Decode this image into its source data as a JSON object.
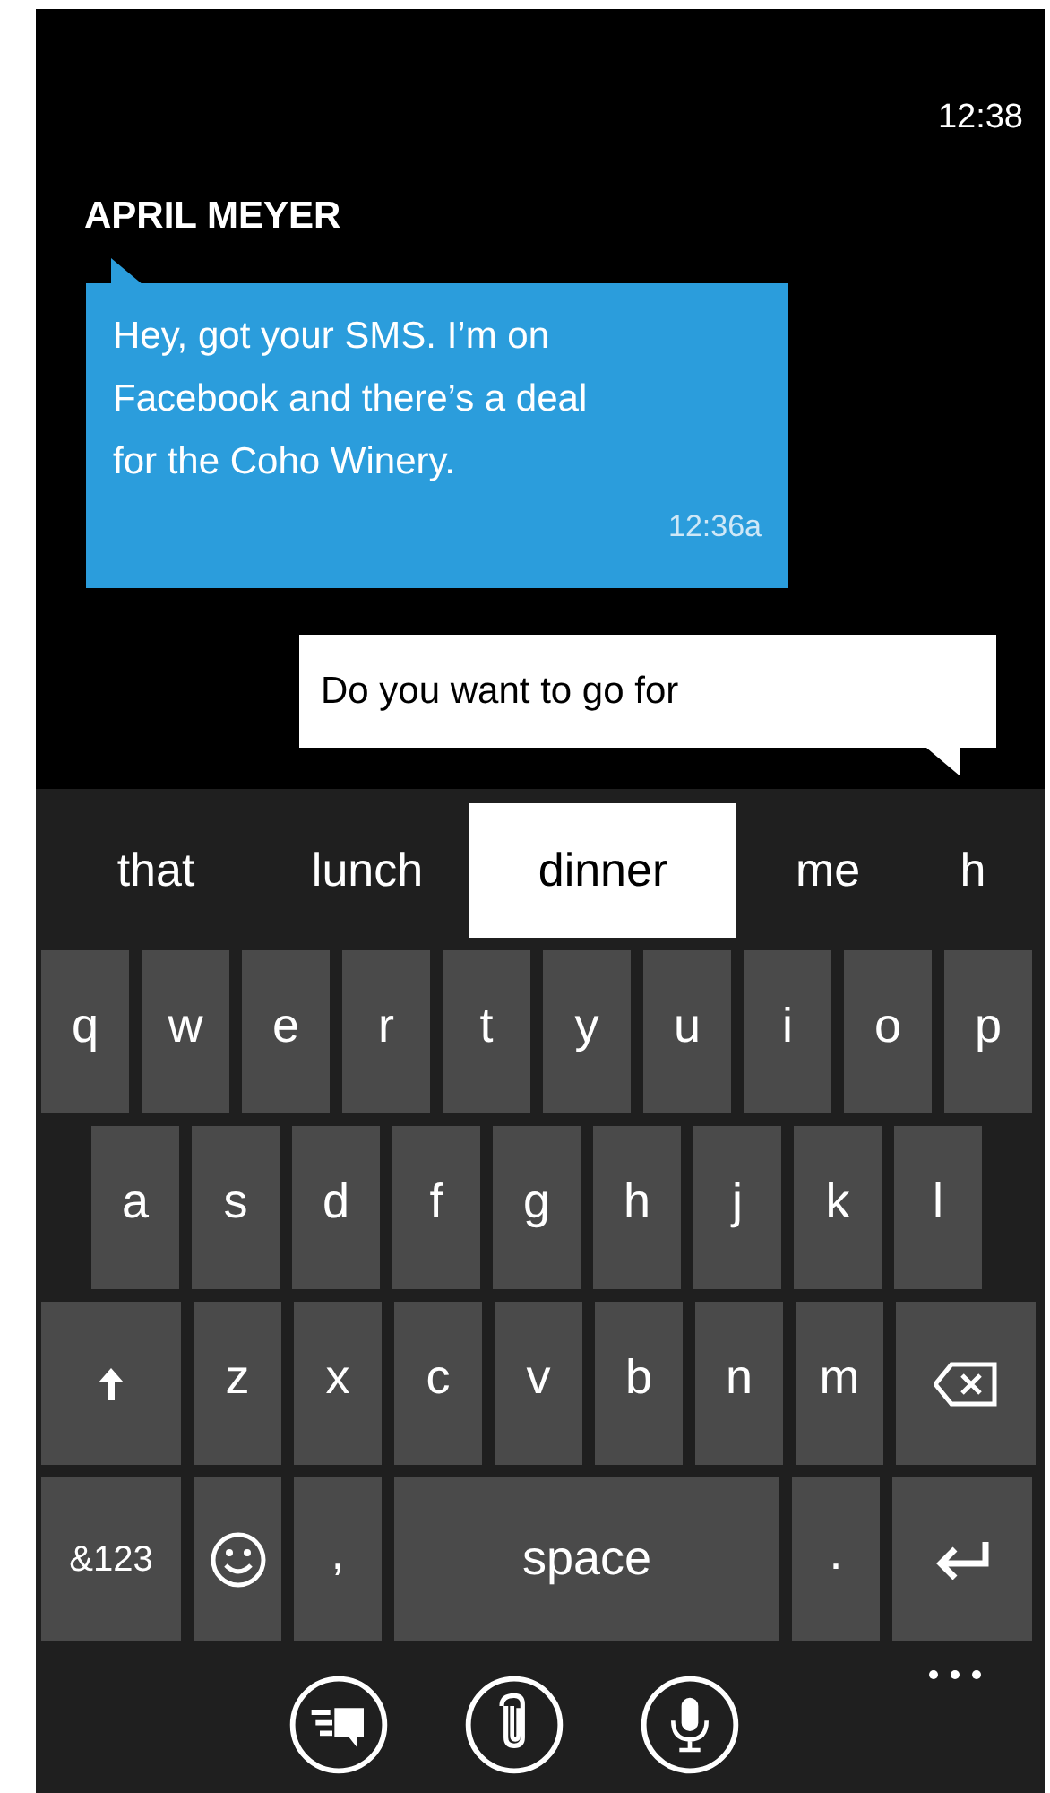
{
  "status_bar": {
    "time": "12:38"
  },
  "contact_name": "APRIL MEYER",
  "incoming_message": {
    "text": "Hey, got your SMS. I’m on Facebook and there’s a deal for the Coho Winery.",
    "time": "12:36a"
  },
  "compose_field": {
    "value": "Do you want to go for"
  },
  "suggestions": [
    {
      "label": "that",
      "selected": false
    },
    {
      "label": "lunch",
      "selected": false
    },
    {
      "label": "dinner",
      "selected": true
    },
    {
      "label": "me",
      "selected": false
    },
    {
      "label": "h",
      "selected": false
    }
  ],
  "keyboard": {
    "rows": [
      {
        "keys": [
          {
            "kind": "letter",
            "label": "q"
          },
          {
            "kind": "letter",
            "label": "w"
          },
          {
            "kind": "letter",
            "label": "e"
          },
          {
            "kind": "letter",
            "label": "r"
          },
          {
            "kind": "letter",
            "label": "t"
          },
          {
            "kind": "letter",
            "label": "y"
          },
          {
            "kind": "letter",
            "label": "u"
          },
          {
            "kind": "letter",
            "label": "i"
          },
          {
            "kind": "letter",
            "label": "o"
          },
          {
            "kind": "letter",
            "label": "p"
          }
        ]
      },
      {
        "keys": [
          {
            "kind": "letter",
            "label": "a"
          },
          {
            "kind": "letter",
            "label": "s"
          },
          {
            "kind": "letter",
            "label": "d"
          },
          {
            "kind": "letter",
            "label": "f"
          },
          {
            "kind": "letter",
            "label": "g"
          },
          {
            "kind": "letter",
            "label": "h"
          },
          {
            "kind": "letter",
            "label": "j"
          },
          {
            "kind": "letter",
            "label": "k"
          },
          {
            "kind": "letter",
            "label": "l"
          }
        ]
      },
      {
        "keys": [
          {
            "kind": "shift"
          },
          {
            "kind": "letter",
            "label": "z"
          },
          {
            "kind": "letter",
            "label": "x"
          },
          {
            "kind": "letter",
            "label": "c"
          },
          {
            "kind": "letter",
            "label": "v"
          },
          {
            "kind": "letter",
            "label": "b"
          },
          {
            "kind": "letter",
            "label": "n"
          },
          {
            "kind": "letter",
            "label": "m"
          },
          {
            "kind": "backspace"
          }
        ]
      },
      {
        "keys": [
          {
            "kind": "symbols",
            "label": "&123"
          },
          {
            "kind": "emoji"
          },
          {
            "kind": "letter",
            "label": ","
          },
          {
            "kind": "space",
            "label": "space"
          },
          {
            "kind": "letter",
            "label": "."
          },
          {
            "kind": "enter"
          }
        ]
      }
    ]
  },
  "app_bar": [
    {
      "kind": "send"
    },
    {
      "kind": "attach"
    },
    {
      "kind": "voice"
    }
  ]
}
